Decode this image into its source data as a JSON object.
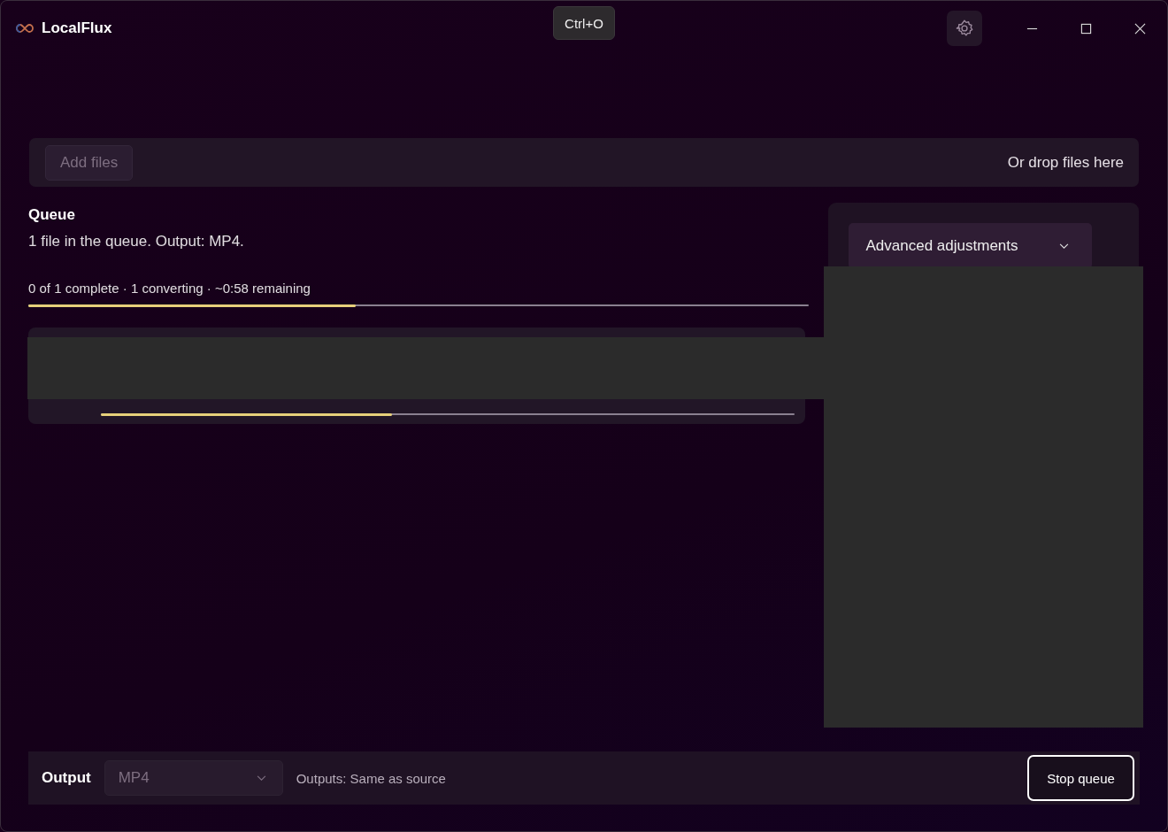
{
  "window": {
    "title": "LocalFlux",
    "tooltip": "Ctrl+O"
  },
  "drop_bar": {
    "add_button": {
      "label": "Add files",
      "disabled": true
    },
    "hint": "Or drop files here"
  },
  "queue": {
    "title": "Queue",
    "summary": "1 file in the queue. Output: MP4.",
    "status": "0 of 1 complete · 1 converting · ~0:58 remaining",
    "level": 0.42,
    "items": [
      {
        "level": 0.42
      }
    ]
  },
  "side_panel": {
    "expander": {
      "label": "Advanced adjustments",
      "expanded": false
    }
  },
  "footer": {
    "label": "Output",
    "format": {
      "value": "MP4",
      "disabled": true
    },
    "outputs": "Outputs: Same as source",
    "button": "Stop queue"
  }
}
